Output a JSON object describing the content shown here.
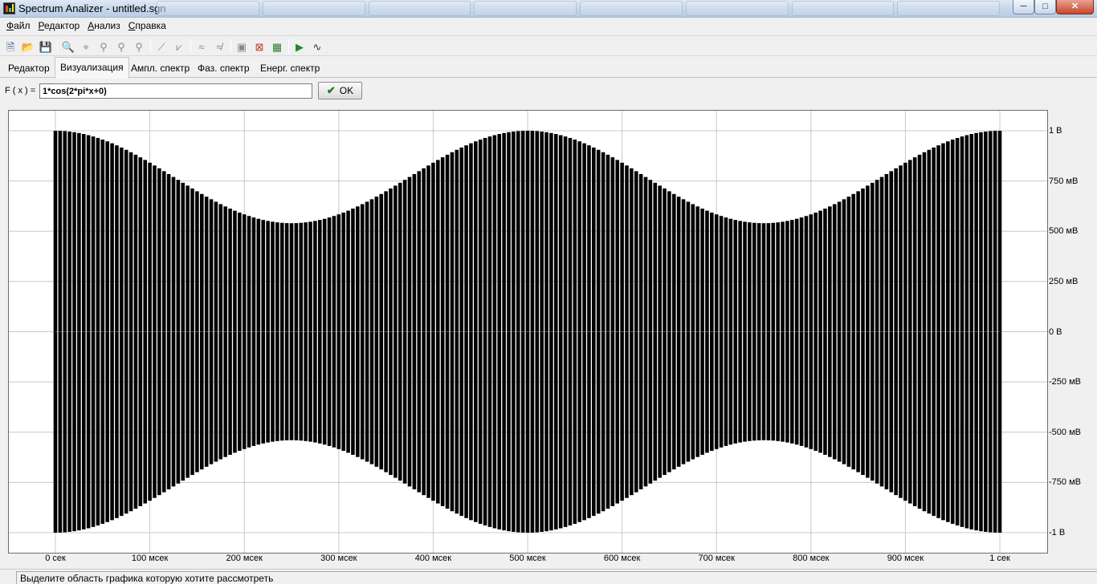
{
  "window": {
    "title": "Spectrum Analizer - untitled.sgn",
    "minimize": "─",
    "maximize": "□",
    "close": "✕"
  },
  "background_tabs": [
    "",
    "",
    "",
    "",
    "",
    "",
    "",
    ""
  ],
  "menu": [
    {
      "label": "Файл",
      "accel": "Ф",
      "rest": "айл"
    },
    {
      "label": "Редактор",
      "accel": "Р",
      "rest": "едактор"
    },
    {
      "label": "Анализ",
      "accel": "А",
      "rest": "нализ"
    },
    {
      "label": "Справка",
      "accel": "С",
      "rest": "правка"
    }
  ],
  "toolbar": [
    {
      "name": "new-file-icon",
      "glyph": "🗎",
      "color": "#2a4f8f"
    },
    {
      "name": "open-folder-icon",
      "glyph": "📂",
      "color": "#c9a227"
    },
    {
      "name": "save-icon",
      "glyph": "💾",
      "color": "#1f3f7a"
    },
    {
      "sep": true
    },
    {
      "name": "magnifier-icon",
      "glyph": "🔍",
      "color": "#8a8a8a"
    },
    {
      "name": "crosshair-icon",
      "glyph": "⌖",
      "color": "#8a8a8a"
    },
    {
      "name": "marker-icon",
      "glyph": "⚲",
      "color": "#8a8a8a"
    },
    {
      "name": "marker-add-icon",
      "glyph": "⚲",
      "color": "#8a8a8a"
    },
    {
      "name": "marker-remove-icon",
      "glyph": "⚲",
      "color": "#8a8a8a"
    },
    {
      "sep": true
    },
    {
      "name": "line-tool-icon",
      "glyph": "⟋",
      "color": "#8a8a8a"
    },
    {
      "name": "range-tool-icon",
      "glyph": "⩗",
      "color": "#8a8a8a"
    },
    {
      "sep": true
    },
    {
      "name": "filter-icon",
      "glyph": "≈",
      "color": "#8a8a8a"
    },
    {
      "name": "filter-inverse-icon",
      "glyph": "≉",
      "color": "#8a8a8a"
    },
    {
      "sep": true
    },
    {
      "name": "zoom-region-icon",
      "glyph": "▣",
      "color": "#8a8a8a"
    },
    {
      "name": "zoom-reset-icon",
      "glyph": "⊠",
      "color": "#c0392b"
    },
    {
      "name": "export-image-icon",
      "glyph": "▦",
      "color": "#2e7d32"
    },
    {
      "sep": true
    },
    {
      "name": "play-icon",
      "glyph": "▶",
      "color": "#1e8a2e"
    },
    {
      "name": "waveform-icon",
      "glyph": "∿",
      "color": "#333333"
    }
  ],
  "tabs": [
    {
      "label": "Редактор",
      "active": false
    },
    {
      "label": "Визуализация",
      "active": true
    },
    {
      "label": "Ампл. спектр",
      "active": false
    },
    {
      "label": "Фаз. спектр",
      "active": false
    },
    {
      "label": "Енерг. спектр",
      "active": false
    }
  ],
  "formula": {
    "label": "F ( x ) =",
    "value": "1*cos(2*pi*x+0)",
    "ok_label": "OK"
  },
  "chart_data": {
    "type": "line",
    "title": "",
    "xlabel": "",
    "ylabel": "",
    "xlim": [
      0,
      1
    ],
    "ylim": [
      -1,
      1
    ],
    "grid": true,
    "x_ticks": [
      {
        "value": 0,
        "label": "0 сек"
      },
      {
        "value": 0.1,
        "label": "100 мсек"
      },
      {
        "value": 0.2,
        "label": "200 мсек"
      },
      {
        "value": 0.3,
        "label": "300 мсек"
      },
      {
        "value": 0.4,
        "label": "400 мсек"
      },
      {
        "value": 0.5,
        "label": "500 мсек"
      },
      {
        "value": 0.6,
        "label": "600 мсек"
      },
      {
        "value": 0.7,
        "label": "700 мсек"
      },
      {
        "value": 0.8,
        "label": "800 мсек"
      },
      {
        "value": 0.9,
        "label": "900 мсек"
      },
      {
        "value": 1,
        "label": "1 сек"
      }
    ],
    "y_ticks": [
      {
        "value": 1,
        "label": "1 В"
      },
      {
        "value": 0.75,
        "label": "750 мВ"
      },
      {
        "value": 0.5,
        "label": "500 мВ"
      },
      {
        "value": 0.25,
        "label": "250 мВ"
      },
      {
        "value": 0,
        "label": "0 В"
      },
      {
        "value": -0.25,
        "label": "-250 мВ"
      },
      {
        "value": -0.5,
        "label": "-500 мВ"
      },
      {
        "value": -0.75,
        "label": "-750 мВ"
      },
      {
        "value": -1,
        "label": "-1 В"
      }
    ],
    "signal": {
      "description_formula": "1*cos(2*pi*x+0)",
      "samples_per_second": 200,
      "envelope_max": 1,
      "envelope_min": 0.54,
      "envelope_periods": 2,
      "color": "#000000"
    }
  },
  "status": {
    "text": "Выделите область графика которую хотите рассмотреть"
  }
}
